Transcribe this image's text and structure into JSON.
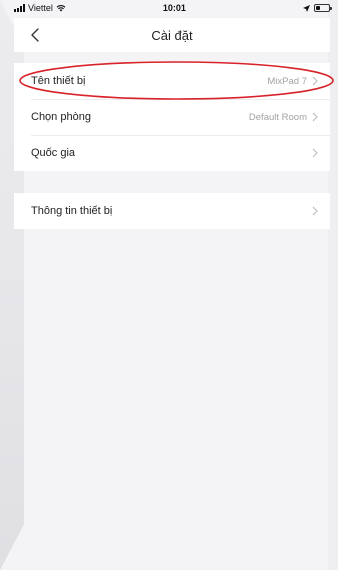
{
  "status_bar": {
    "carrier": "Viettel",
    "time": "10:01"
  },
  "nav": {
    "title": "Cài đặt"
  },
  "settings_group_1": [
    {
      "label": "Tên thiết bị",
      "value": "MixPad 7"
    },
    {
      "label": "Chọn phòng",
      "value": "Default Room"
    },
    {
      "label": "Quốc gia",
      "value": ""
    }
  ],
  "settings_group_2": [
    {
      "label": "Thông tin thiết bị",
      "value": ""
    }
  ],
  "colors": {
    "annotation": "#d8232a",
    "background": "#f4f4f6"
  },
  "icons": {
    "back": "chevron-left-icon",
    "row_arrow": "chevron-right-icon",
    "wifi": "wifi-icon",
    "battery": "battery-icon",
    "location": "location-arrow-icon"
  }
}
